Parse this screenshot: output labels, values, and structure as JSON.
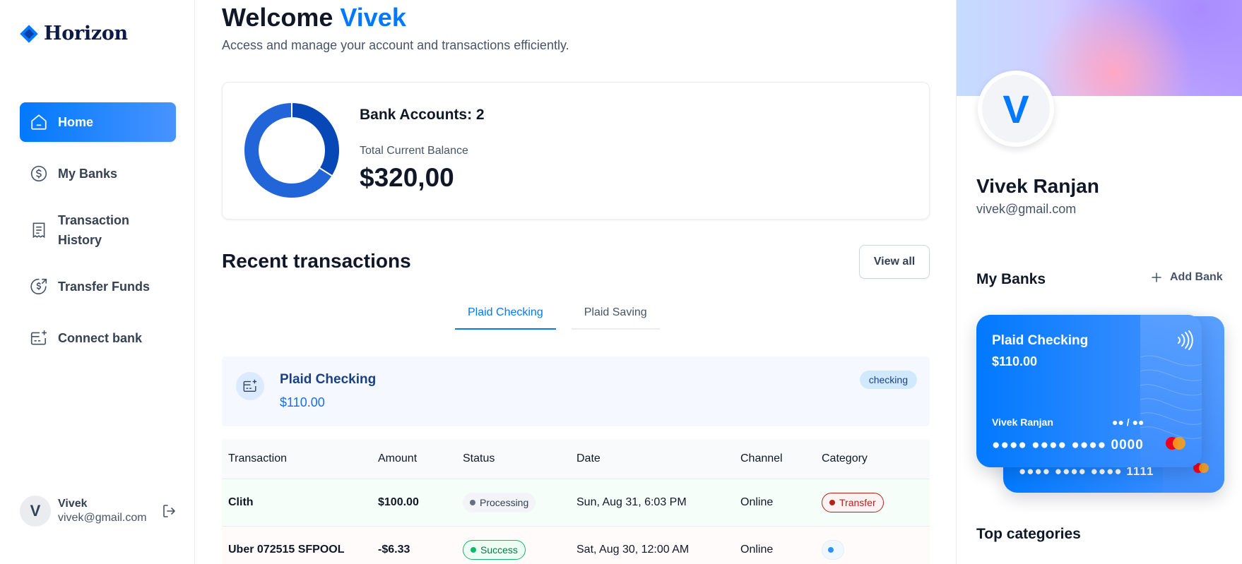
{
  "brand": {
    "name": "Horizon"
  },
  "sidebar": {
    "items": [
      {
        "label": "Home",
        "icon": "home-icon",
        "active": true
      },
      {
        "label": "My Banks",
        "icon": "dollar-circle-icon"
      },
      {
        "label": "Transaction History",
        "icon": "receipt-icon"
      },
      {
        "label": "Transfer Funds",
        "icon": "money-send-icon"
      },
      {
        "label": "Connect bank",
        "icon": "card-add-icon"
      }
    ],
    "footer": {
      "avatar_initial": "V",
      "name": "Vivek",
      "email": "vivek@gmail.com",
      "logout_icon": "logout-icon"
    }
  },
  "header": {
    "welcome_prefix": "Welcome",
    "user_first_name": "Vivek",
    "subtitle": "Access and manage your account and transactions efficiently."
  },
  "balance": {
    "accounts_label": "Bank Accounts: 2",
    "total_label": "Total Current Balance",
    "total_value": "$320,00",
    "donut_shares": [
      0.34,
      0.66
    ],
    "donut_colors": [
      "#0747b6",
      "#2265d8"
    ]
  },
  "recent": {
    "title": "Recent transactions",
    "view_all": "View all",
    "tabs": [
      {
        "label": "Plaid Checking",
        "active": true
      },
      {
        "label": "Plaid Saving",
        "active": false
      }
    ],
    "account": {
      "name": "Plaid Checking",
      "balance": "$110.00",
      "type": "checking",
      "icon": "card-add-icon"
    },
    "columns": [
      "Transaction",
      "Amount",
      "Status",
      "Date",
      "Channel",
      "Category"
    ],
    "rows": [
      {
        "name": "Clith",
        "amount": "$100.00",
        "status": "Processing",
        "date": "Sun, Aug 31, 6:03 PM",
        "channel": "Online",
        "category": "Transfer"
      },
      {
        "name": "Uber 072515 SFPOOL",
        "amount": "-$6.33",
        "status": "Success",
        "date": "Sat, Aug 30, 12:00 AM",
        "channel": "Online",
        "category": ""
      }
    ]
  },
  "profile": {
    "avatar_initial": "V",
    "name": "Vivek Ranjan",
    "email": "vivek@gmail.com"
  },
  "my_banks": {
    "title": "My Banks",
    "add_label": "Add Bank",
    "card_front": {
      "name": "Plaid Checking",
      "balance": "$110.00",
      "holder": "Vivek Ranjan",
      "expiry": "●● / ●●",
      "number": "●●●● ●●●● ●●●● 0000"
    },
    "card_back": {
      "number": "●●●● ●●●● ●●●● 1111"
    }
  },
  "top_categories": {
    "title": "Top categories"
  },
  "colors": {
    "accent": "#0179fe",
    "success": "#039855",
    "danger": "#f04438"
  }
}
